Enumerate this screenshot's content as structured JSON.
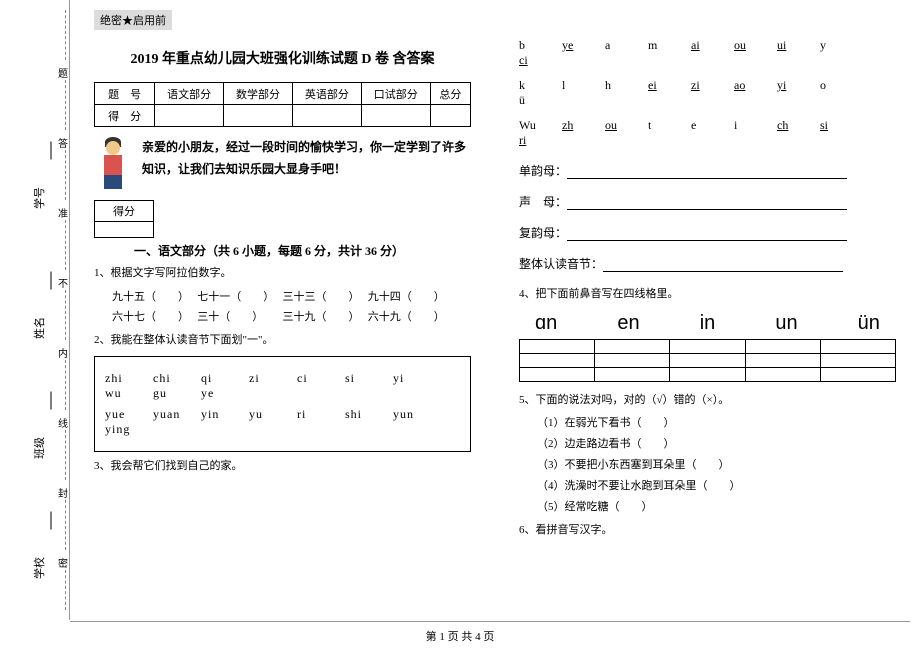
{
  "side": {
    "labels": [
      "学校",
      "班级",
      "姓名",
      "学号"
    ],
    "seal_chars": [
      "密",
      "封",
      "线",
      "内",
      "不",
      "准",
      "答",
      "题"
    ]
  },
  "secret": "绝密★启用前",
  "title": "2019 年重点幼儿园大班强化训练试题 D 卷 含答案",
  "score_table": {
    "row1": [
      "题　号",
      "语文部分",
      "数学部分",
      "英语部分",
      "口试部分",
      "总分"
    ],
    "row2": [
      "得　分",
      "",
      "",
      "",
      "",
      ""
    ]
  },
  "intro": "亲爱的小朋友，经过一段时间的愉快学习，你一定学到了许多知识，让我们去知识乐园大显身手吧！",
  "mini_label": "得分",
  "section1_h": "一、语文部分（共 6 小题，每题 6 分，共计 36 分）",
  "q1": "1、根据文字写阿拉伯数字。",
  "q1_items": [
    "九十五（　　）",
    "七十一（　　）",
    "三十三（　　）",
    "九十四（　　）",
    "六十七（　　）",
    "三十（　　）",
    "三十九（　　）",
    "六十九（　　）"
  ],
  "q2": "2、我能在整体认读音节下面划\"一\"。",
  "q2_rows": [
    [
      "zhi",
      "chi",
      "qi",
      "zi",
      "ci",
      "si",
      "yi",
      "wu",
      "gu",
      "ye"
    ],
    [
      "yue",
      "yuan",
      "yin",
      "yu",
      "ri",
      "shi",
      "yun",
      "ying",
      "",
      ""
    ]
  ],
  "q3": "3、我会帮它们找到自己的家。",
  "right_rows": [
    [
      {
        "t": "b"
      },
      {
        "t": "ye",
        "u": 1
      },
      {
        "t": "a"
      },
      {
        "t": "m"
      },
      {
        "t": "ai",
        "u": 1
      },
      {
        "t": "ou",
        "u": 1
      },
      {
        "t": "ui",
        "u": 1
      },
      {
        "t": "y"
      },
      {
        "t": "ci",
        "u": 1
      }
    ],
    [
      {
        "t": "k"
      },
      {
        "t": "l"
      },
      {
        "t": "h"
      },
      {
        "t": "ei",
        "u": 1
      },
      {
        "t": "zi",
        "u": 1
      },
      {
        "t": "ao",
        "u": 1
      },
      {
        "t": "yi",
        "u": 1
      },
      {
        "t": "o"
      },
      {
        "t": "ü"
      }
    ],
    [
      {
        "t": "Wu"
      },
      {
        "t": "zh",
        "u": 1
      },
      {
        "t": "ou",
        "u": 1
      },
      {
        "t": "t"
      },
      {
        "t": "e"
      },
      {
        "t": "i"
      },
      {
        "t": "ch",
        "u": 1
      },
      {
        "t": "si",
        "u": 1
      },
      {
        "t": "ri",
        "u": 1
      }
    ]
  ],
  "cat_labels": [
    "单韵母：",
    "声　母：",
    "复韵母：",
    "整体认读音节："
  ],
  "q4": "4、把下面前鼻音写在四线格里。",
  "q4_big": [
    "ɑn",
    "en",
    "in",
    "un",
    "ün"
  ],
  "q5": "5、下面的说法对吗，对的（√）错的（×）。",
  "q5_items": [
    "（1）在弱光下看书（　　）",
    "（2）边走路边看书（　　）",
    "（3）不要把小东西塞到耳朵里（　　）",
    "（4）洗澡时不要让水跑到耳朵里（　　）",
    "（5）经常吃糖（　　）"
  ],
  "q6": "6、看拼音写汉字。",
  "footer": "第 1 页 共 4 页"
}
